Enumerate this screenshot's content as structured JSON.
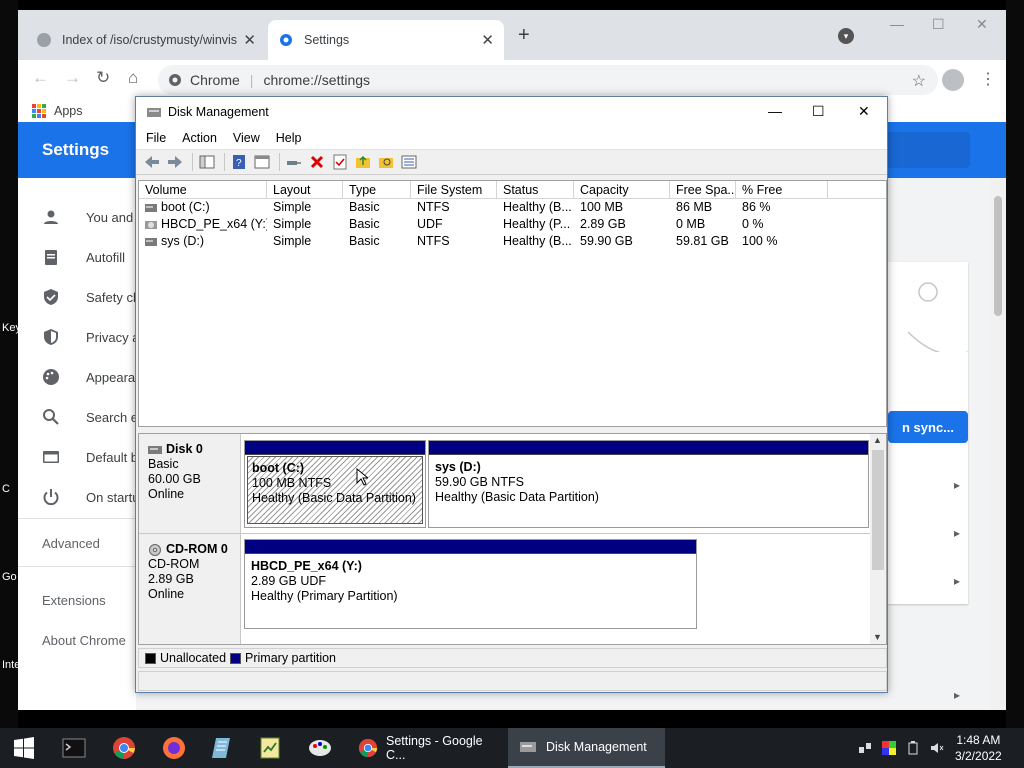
{
  "desktop": {
    "edge_texts": [
      "Key",
      "C",
      "Go",
      "Inte"
    ]
  },
  "chrome": {
    "tabs": [
      {
        "title": "Index of /iso/crustymusty/winvist",
        "active": false
      },
      {
        "title": "Settings",
        "active": true
      }
    ],
    "omnibox": {
      "site_label": "Chrome",
      "url": "chrome://settings"
    },
    "bookmarks": {
      "apps_label": "Apps"
    },
    "settings": {
      "header_title": "Settings",
      "sidebar_items": [
        {
          "label": "You and",
          "icon": "person-icon"
        },
        {
          "label": "Autofill",
          "icon": "clipboard-icon"
        },
        {
          "label": "Safety cl",
          "icon": "shield-check-icon"
        },
        {
          "label": "Privacy a",
          "icon": "shield-icon"
        },
        {
          "label": "Appeara",
          "icon": "palette-icon"
        },
        {
          "label": "Search e",
          "icon": "search-icon"
        },
        {
          "label": "Default b",
          "icon": "browser-icon"
        },
        {
          "label": "On startu",
          "icon": "power-icon"
        }
      ],
      "advanced_label": "Advanced",
      "extensions_label": "Extensions",
      "about_label": "About Chrome",
      "sync_button_label": "n sync..."
    }
  },
  "disk_management": {
    "title": "Disk Management",
    "menu": [
      "File",
      "Action",
      "View",
      "Help"
    ],
    "columns": [
      "Volume",
      "Layout",
      "Type",
      "File System",
      "Status",
      "Capacity",
      "Free Spa...",
      "% Free"
    ],
    "volumes": [
      {
        "volume": "boot (C:)",
        "layout": "Simple",
        "type": "Basic",
        "fs": "NTFS",
        "status": "Healthy (B...",
        "capacity": "100 MB",
        "free": "86 MB",
        "pct": "86 %"
      },
      {
        "volume": "HBCD_PE_x64 (Y:)",
        "layout": "Simple",
        "type": "Basic",
        "fs": "UDF",
        "status": "Healthy (P...",
        "capacity": "2.89 GB",
        "free": "0 MB",
        "pct": "0 %"
      },
      {
        "volume": "sys (D:)",
        "layout": "Simple",
        "type": "Basic",
        "fs": "NTFS",
        "status": "Healthy (B...",
        "capacity": "59.90 GB",
        "free": "59.81 GB",
        "pct": "100 %"
      }
    ],
    "disks": [
      {
        "name": "Disk 0",
        "kind": "Basic",
        "size": "60.00 GB",
        "state": "Online",
        "partitions": [
          {
            "name": "boot  (C:)",
            "size_fs": "100 MB NTFS",
            "status": "Healthy (Basic Data Partition)"
          },
          {
            "name": "sys  (D:)",
            "size_fs": "59.90 GB NTFS",
            "status": "Healthy (Basic Data Partition)"
          }
        ]
      },
      {
        "name": "CD-ROM 0",
        "kind": "CD-ROM",
        "size": "2.89 GB",
        "state": "Online",
        "partitions": [
          {
            "name": "HBCD_PE_x64  (Y:)",
            "size_fs": "2.89 GB UDF",
            "status": "Healthy (Primary Partition)"
          }
        ]
      }
    ],
    "legend": [
      {
        "label": "Unallocated",
        "color": "#000000"
      },
      {
        "label": "Primary partition",
        "color": "#000080"
      }
    ]
  },
  "taskbar": {
    "tasks": [
      {
        "label": "Settings - Google C...",
        "active": false
      },
      {
        "label": "Disk Management",
        "active": true
      }
    ],
    "clock": {
      "time": "1:48 AM",
      "date": "3/2/2022"
    }
  },
  "colors": {
    "chrome_blue": "#1a73e8",
    "partition_bar": "#000080",
    "taskbar_bg": "#1b1f24"
  }
}
